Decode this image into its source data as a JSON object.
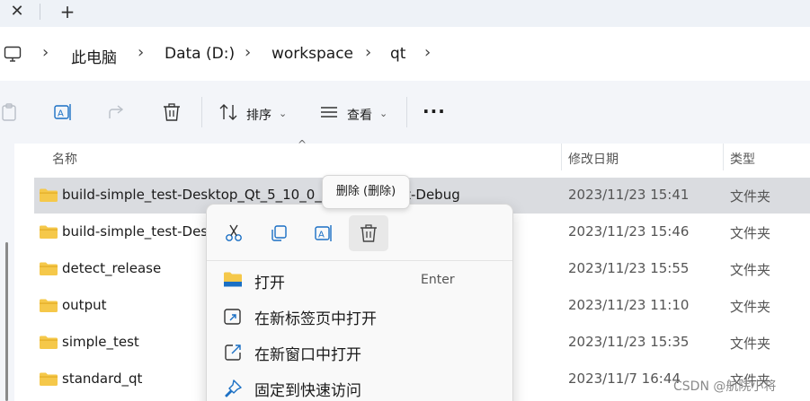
{
  "tabs": {
    "close_glyph": "✕",
    "new_glyph": "+"
  },
  "breadcrumb": {
    "root_icon": "computer-icon",
    "items": [
      "此电脑",
      "Data (D:)",
      "workspace",
      "qt"
    ]
  },
  "commandbar": {
    "sort_label": "排序",
    "view_label": "查看",
    "more_label": "···"
  },
  "columns": {
    "name": "名称",
    "modified": "修改日期",
    "type": "类型"
  },
  "files": [
    {
      "name": "build-simple_test-Desktop_Qt_5_10_0_MinGW_32bit-Debug",
      "modified": "2023/11/23 15:41",
      "type": "文件夹",
      "selected": true
    },
    {
      "name": "build-simple_test-Desktop_Qt_5_10_0_MinGW_32bit-Release",
      "modified": "2023/11/23 15:46",
      "type": "文件夹"
    },
    {
      "name": "detect_release",
      "modified": "2023/11/23 15:55",
      "type": "文件夹"
    },
    {
      "name": "output",
      "modified": "2023/11/23 11:10",
      "type": "文件夹"
    },
    {
      "name": "simple_test",
      "modified": "2023/11/23 15:35",
      "type": "文件夹"
    },
    {
      "name": "standard_qt",
      "modified": "2023/11/7 16:44",
      "type": "文件夹"
    }
  ],
  "tooltip": {
    "text": "删除 (删除)"
  },
  "context_menu": {
    "quick_actions": [
      "cut-icon",
      "copy-icon",
      "rename-icon",
      "delete-icon"
    ],
    "items": [
      {
        "label": "打开",
        "shortcut": "Enter"
      },
      {
        "label": "在新标签页中打开"
      },
      {
        "label": "在新窗口中打开"
      },
      {
        "label": "固定到快速访问"
      }
    ]
  },
  "watermark": "CSDN @航院小将",
  "colors": {
    "folder": "#f5c84a",
    "folder_dark": "#e2ac25",
    "accent": "#1a6fc4",
    "selection": "#dadce0"
  }
}
